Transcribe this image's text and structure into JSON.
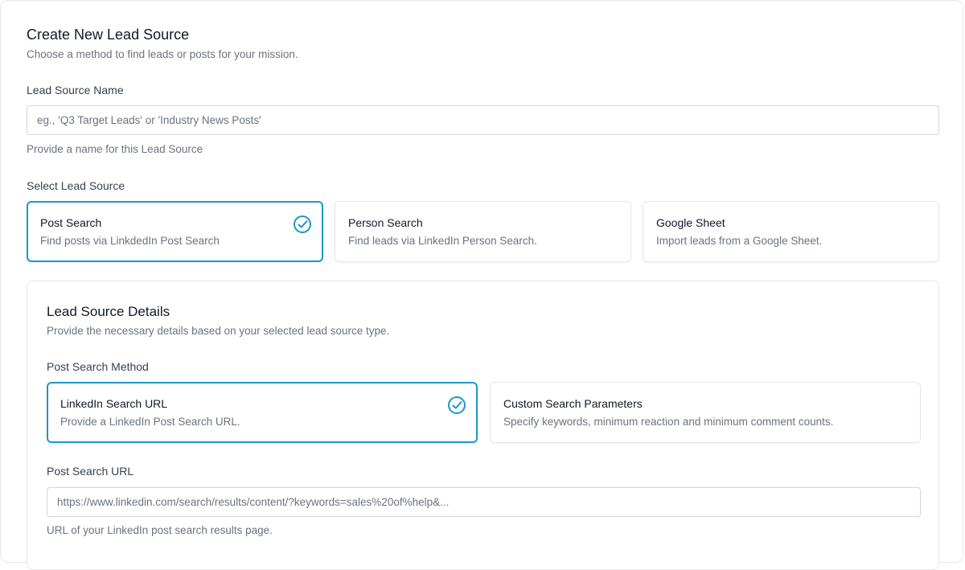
{
  "header": {
    "title": "Create New Lead Source",
    "subtitle": "Choose a method to find leads or posts for your mission."
  },
  "name_field": {
    "label": "Lead Source Name",
    "placeholder": "eg., 'Q3 Target Leads' or 'Industry News Posts'",
    "value": "",
    "help": "Provide a name for this Lead Source"
  },
  "lead_source": {
    "label": "Select Lead Source",
    "options": [
      {
        "title": "Post Search",
        "description": "Find posts via LinkdedIn Post Search",
        "selected": true
      },
      {
        "title": "Person Search",
        "description": "Find leads via LinkedIn Person Search.",
        "selected": false
      },
      {
        "title": "Google Sheet",
        "description": "Import leads from a Google Sheet.",
        "selected": false
      }
    ]
  },
  "details": {
    "title": "Lead Source Details",
    "subtitle": "Provide the necessary details based on your selected lead source type.",
    "method_label": "Post Search Method",
    "methods": [
      {
        "title": "LinkedIn Search URL",
        "description": "Provide a LinkedIn Post Search URL.",
        "selected": true
      },
      {
        "title": "Custom Search Parameters",
        "description": "Specify keywords, minimum reaction and minimum comment counts.",
        "selected": false
      }
    ],
    "url_field": {
      "label": "Post Search URL",
      "placeholder": "https://www.linkedin.com/search/results/content/?keywords=sales%20of%help&...",
      "value": "",
      "help": "URL of your LinkedIn post search results page."
    }
  },
  "colors": {
    "accent": "#1d97c8",
    "border": "#e5e7eb",
    "muted_text": "#6b7280"
  },
  "icons": {
    "selected": "check-circle-icon"
  }
}
